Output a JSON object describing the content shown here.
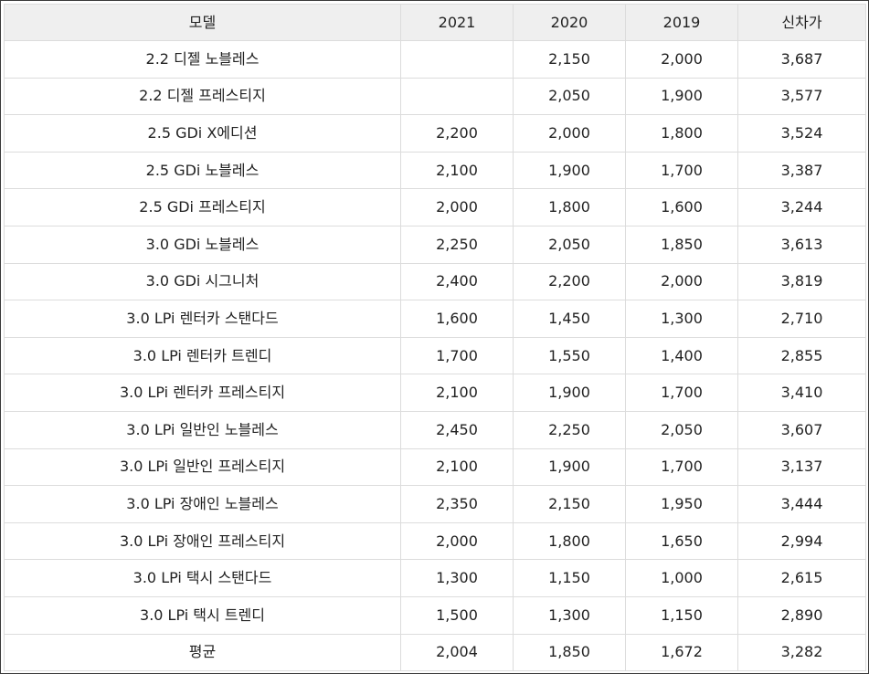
{
  "table": {
    "headers": [
      "모델",
      "2021",
      "2020",
      "2019",
      "신차가"
    ],
    "rows": [
      [
        "2.2 디젤 노블레스",
        "",
        "2,150",
        "2,000",
        "3,687"
      ],
      [
        "2.2 디젤 프레스티지",
        "",
        "2,050",
        "1,900",
        "3,577"
      ],
      [
        "2.5 GDi X에디션",
        "2,200",
        "2,000",
        "1,800",
        "3,524"
      ],
      [
        "2.5 GDi 노블레스",
        "2,100",
        "1,900",
        "1,700",
        "3,387"
      ],
      [
        "2.5 GDi 프레스티지",
        "2,000",
        "1,800",
        "1,600",
        "3,244"
      ],
      [
        "3.0 GDi 노블레스",
        "2,250",
        "2,050",
        "1,850",
        "3,613"
      ],
      [
        "3.0 GDi 시그니처",
        "2,400",
        "2,200",
        "2,000",
        "3,819"
      ],
      [
        "3.0 LPi 렌터카 스탠다드",
        "1,600",
        "1,450",
        "1,300",
        "2,710"
      ],
      [
        "3.0 LPi 렌터카 트렌디",
        "1,700",
        "1,550",
        "1,400",
        "2,855"
      ],
      [
        "3.0 LPi 렌터카 프레스티지",
        "2,100",
        "1,900",
        "1,700",
        "3,410"
      ],
      [
        "3.0 LPi 일반인 노블레스",
        "2,450",
        "2,250",
        "2,050",
        "3,607"
      ],
      [
        "3.0 LPi 일반인 프레스티지",
        "2,100",
        "1,900",
        "1,700",
        "3,137"
      ],
      [
        "3.0 LPi 장애인 노블레스",
        "2,350",
        "2,150",
        "1,950",
        "3,444"
      ],
      [
        "3.0 LPi 장애인 프레스티지",
        "2,000",
        "1,800",
        "1,650",
        "2,994"
      ],
      [
        "3.0 LPi 택시 스탠다드",
        "1,300",
        "1,150",
        "1,000",
        "2,615"
      ],
      [
        "3.0 LPi 택시 트렌디",
        "1,500",
        "1,300",
        "1,150",
        "2,890"
      ],
      [
        "평균",
        "2,004",
        "1,850",
        "1,672",
        "3,282"
      ]
    ]
  }
}
